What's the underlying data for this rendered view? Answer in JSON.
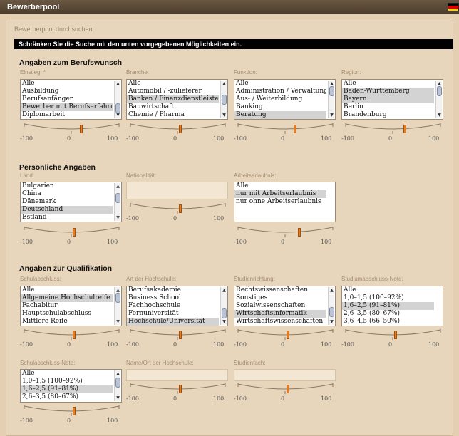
{
  "window": {
    "title": "Bewerberpool"
  },
  "colors": {
    "handle": "#e57d1d",
    "selection": "#d3d3d3",
    "background": "#e4cfb2"
  },
  "search": {
    "subtitle": "Bewerberpool durchsuchen",
    "instruction": "Schränken Sie die Suche mit den unten vorgegebenen Möglichkeiten ein."
  },
  "slider_labels": {
    "min": "-100",
    "mid": "0",
    "max": "100"
  },
  "sections": {
    "beruf": {
      "heading": "Angaben zum Berufswunsch",
      "einstieg": {
        "label": "Einstieg: *",
        "items": [
          "Alle",
          "Ausbildung",
          "Berufsanfänger",
          "Bewerber mit Berufserfahrung",
          "Diplomarbeit"
        ],
        "selected": [
          3
        ],
        "slider_value": 20
      },
      "branche": {
        "label": "Branche:",
        "items": [
          "Alle",
          "Automobil / -zulieferer",
          "Banken / Finanzdienstleister",
          "Bauwirtschaft",
          "Chemie / Pharma"
        ],
        "selected": [
          2
        ],
        "slider_value": 5
      },
      "funktion": {
        "label": "Funktion:",
        "items": [
          "Alle",
          "Administration / Verwaltung",
          "Aus- / Weiterbildung",
          "Banking",
          "Beratung"
        ],
        "selected": [
          4
        ],
        "slider_value": 20
      },
      "region": {
        "label": "Region:",
        "items": [
          "Alle",
          "Baden-Württemberg",
          "Bayern",
          "Berlin",
          "Brandenburg"
        ],
        "selected": [
          1,
          2
        ],
        "slider_value": 25
      }
    },
    "persoenlich": {
      "heading": "Persönliche Angaben",
      "land": {
        "label": "Land:",
        "items": [
          "Bulgarien",
          "China",
          "Dänemark",
          "Deutschland",
          "Estland"
        ],
        "selected": [
          3
        ],
        "slider_value": 5
      },
      "nationalitaet": {
        "label": "Nationalität:",
        "items": [],
        "slider_value": 5
      },
      "arbeitserlaubnis": {
        "label": "Arbeitserlaubnis:",
        "items": [
          "Alle",
          "nur mit Arbeitserlaubnis",
          "nur ohne Arbeitserlaubnis"
        ],
        "selected": [
          1
        ],
        "slider_value": 30
      }
    },
    "qualifikation": {
      "heading": "Angaben zur Qualifikation",
      "schulabschluss": {
        "label": "Schulabschluss:",
        "items": [
          "Alle",
          "Allgemeine Hochschulreife",
          "Fachabitur",
          "Hauptschulabschluss",
          "Mittlere Reife"
        ],
        "selected": [
          1
        ],
        "slider_value": 5
      },
      "hochschulart": {
        "label": "Art der Hochschule:",
        "items": [
          "Berufsakademie",
          "Business School",
          "Fachhochschule",
          "Fernuniversität",
          "Hochschule/Universität"
        ],
        "selected": [
          4
        ],
        "slider_value": 5
      },
      "studienrichtung": {
        "label": "Studienrichtung:",
        "items": [
          "Rechtswissenschaften",
          "Sonstiges",
          "Sozialwissenschaften",
          "Wirtschaftsinformatik",
          "Wirtschaftswissenschaften"
        ],
        "selected": [
          3
        ],
        "slider_value": 5
      },
      "studiumnote": {
        "label": "Studiumabschluss-Note:",
        "items": [
          "Alle",
          "1,0–1,5 (100–92%)",
          "1,6–2,5 (91–81%)",
          "2,6–3,5 (80–67%)",
          "3,6–4,5 (66–50%)"
        ],
        "selected": [
          2
        ],
        "slider_value": 5
      },
      "schulnote": {
        "label": "Schulabschluss-Note:",
        "items": [
          "Alle",
          "1,0–1,5 (100–92%)",
          "1,6–2,5 (91–81%)",
          "2,6–3,5 (80–67%)"
        ],
        "selected": [
          2
        ],
        "slider_value": 5
      },
      "hochschulname": {
        "label": "Name/Ort der Hochschule:",
        "items": [],
        "slider_value": 5
      },
      "studienfach": {
        "label": "Studienfach:",
        "items": [],
        "slider_value": 5
      }
    }
  }
}
